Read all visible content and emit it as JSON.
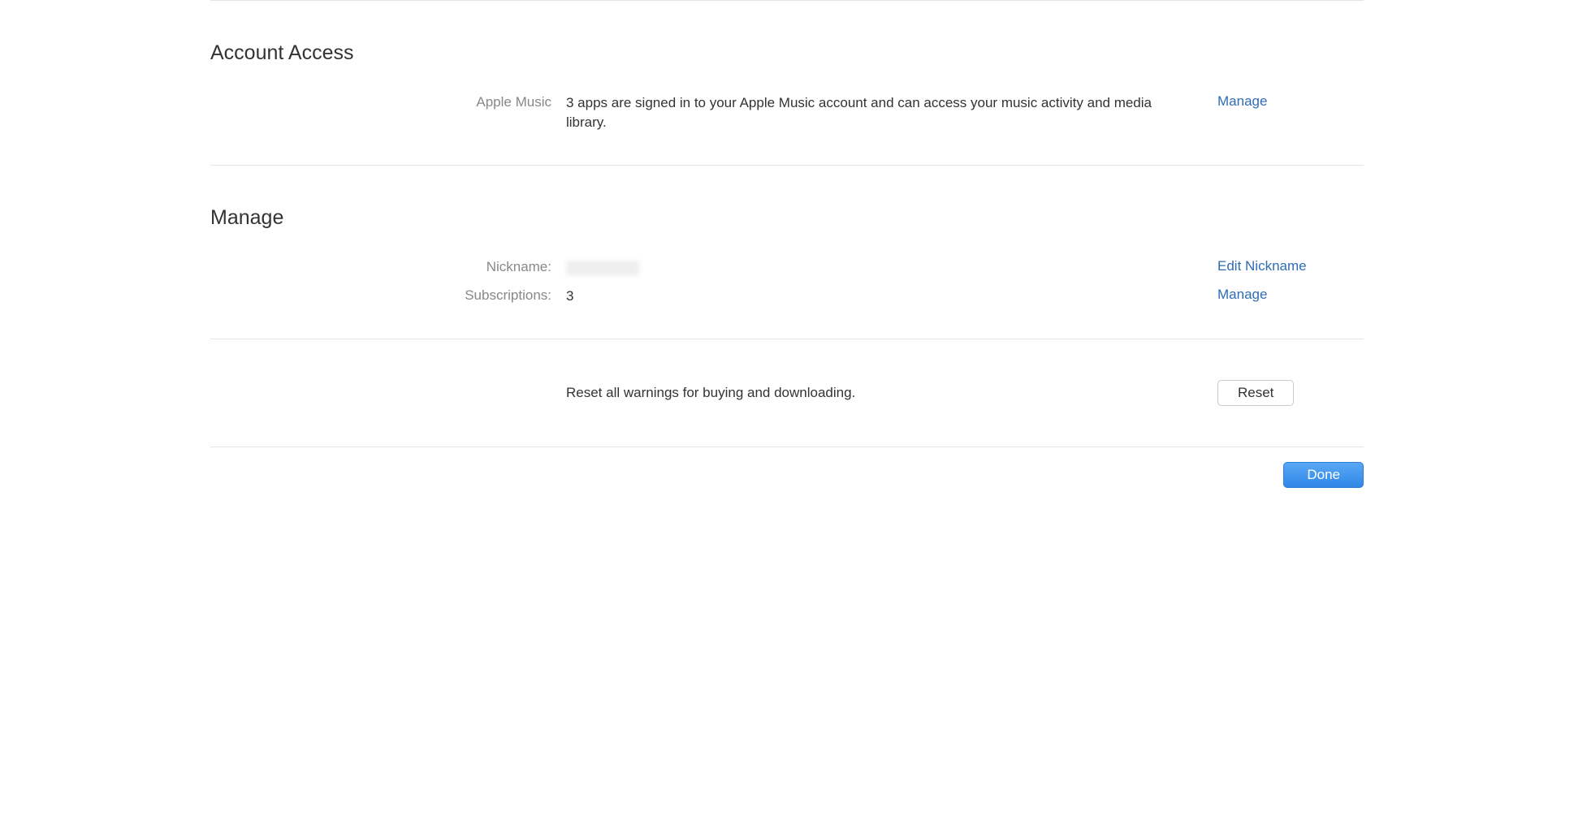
{
  "account_access": {
    "title": "Account Access",
    "apple_music": {
      "label": "Apple Music",
      "description": "3 apps are signed in to your Apple Music account and can access your music activity and media library.",
      "action": "Manage"
    }
  },
  "manage": {
    "title": "Manage",
    "nickname": {
      "label": "Nickname:",
      "value": "",
      "action": "Edit Nickname"
    },
    "subscriptions": {
      "label": "Subscriptions:",
      "value": "3",
      "action": "Manage"
    }
  },
  "reset_warnings": {
    "description": "Reset all warnings for buying and downloading.",
    "button": "Reset"
  },
  "footer": {
    "done": "Done"
  }
}
